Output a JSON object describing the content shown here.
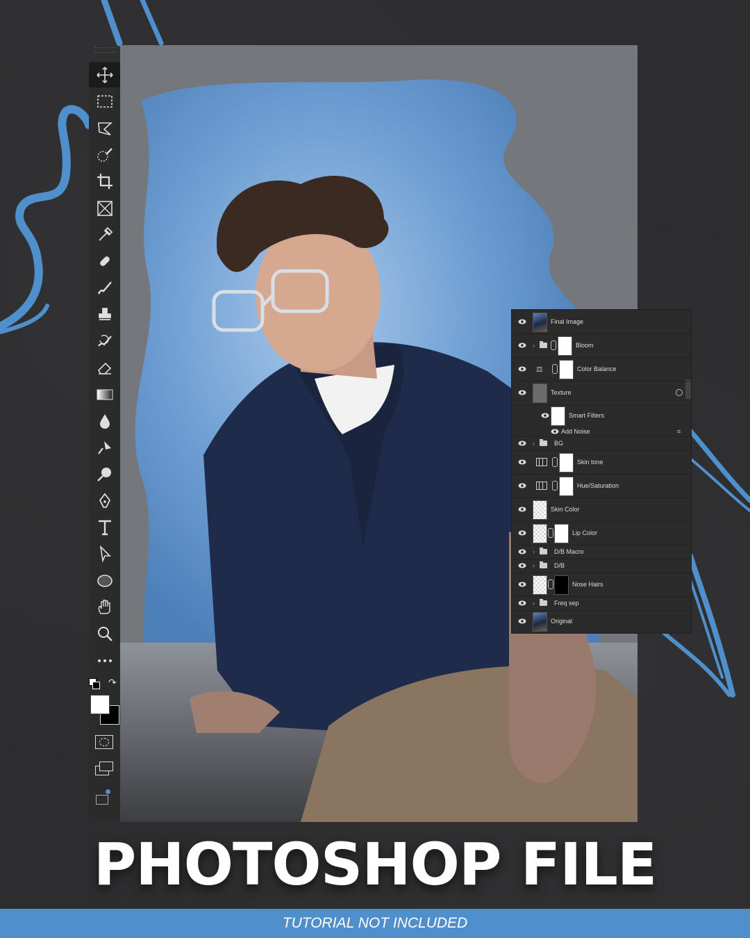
{
  "colors": {
    "accent_blue": "#4f8fcb",
    "background": "#2d2d2f",
    "panel": "#2b2b2b"
  },
  "toolbar": {
    "tools": [
      "move-tool-icon",
      "marquee-tool-icon",
      "lasso-tool-icon",
      "quick-selection-tool-icon",
      "crop-tool-icon",
      "frame-tool-icon",
      "eyedropper-tool-icon",
      "healing-brush-icon",
      "brush-tool-icon",
      "clone-stamp-icon",
      "history-brush-icon",
      "eraser-tool-icon",
      "gradient-tool-icon",
      "blur-tool-icon",
      "dodge-tool-icon",
      "zoom-path-icon",
      "pen-tool-icon",
      "type-tool-icon",
      "path-selection-icon",
      "ellipse-tool-icon",
      "hand-tool-icon",
      "zoom-tool-icon",
      "more-tools-icon"
    ]
  },
  "layers": [
    {
      "name": "Final Image",
      "type": "pixel",
      "thumb": "photo"
    },
    {
      "name": "Bloom",
      "type": "group-mask"
    },
    {
      "name": "Color Balance",
      "type": "adjustment-balance"
    },
    {
      "name": "Texture",
      "type": "smart-object"
    },
    {
      "name": "Smart Filters",
      "type": "smart-filters"
    },
    {
      "name": "Add Noise",
      "type": "filter"
    },
    {
      "name": "BG",
      "type": "group"
    },
    {
      "name": "Skin tone",
      "type": "adjustment"
    },
    {
      "name": "Hue/Saturation",
      "type": "adjustment"
    },
    {
      "name": "Skin Color",
      "type": "transparent"
    },
    {
      "name": "Lip Color",
      "type": "transparent-mask"
    },
    {
      "name": "D/B Macro",
      "type": "group"
    },
    {
      "name": "D/B",
      "type": "group"
    },
    {
      "name": "Nose Hairs",
      "type": "transparent-mask-black"
    },
    {
      "name": "Freq sep",
      "type": "group"
    },
    {
      "name": "Original",
      "type": "pixel",
      "thumb": "photo"
    }
  ],
  "title": "PHOTOSHOP FILE",
  "footer": "TUTORIAL NOT INCLUDED"
}
